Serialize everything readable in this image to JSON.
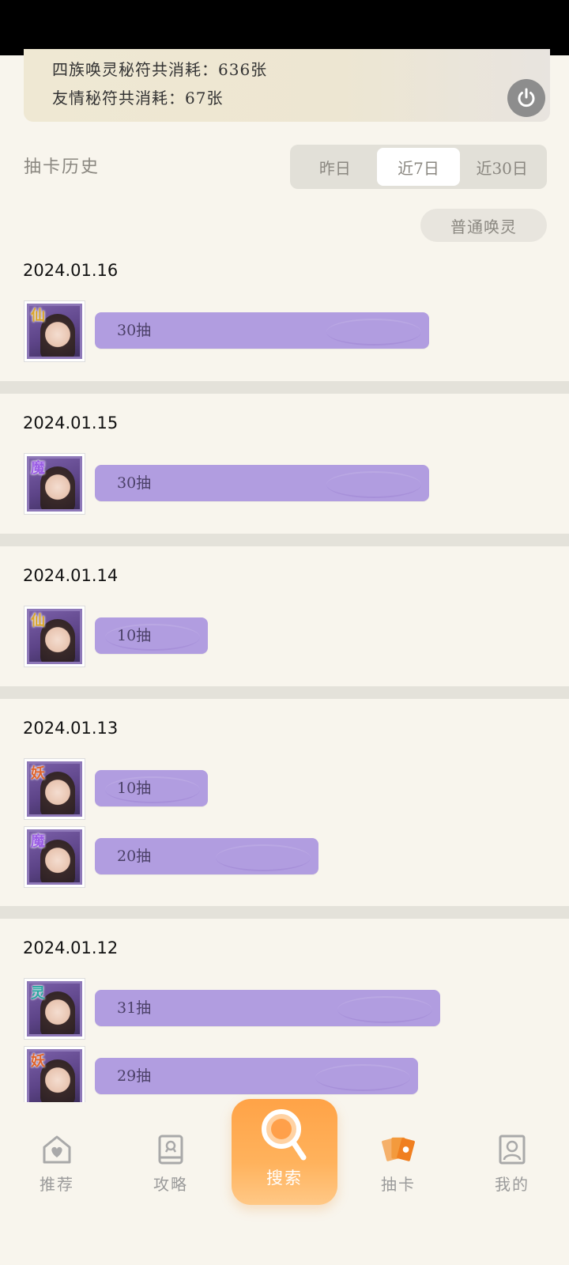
{
  "summary": {
    "line1": "四族唤灵秘符共消耗：636张",
    "line2": "友情秘符共消耗：67张"
  },
  "history": {
    "title": "抽卡历史",
    "tabs": [
      "昨日",
      "近7日",
      "近30日"
    ],
    "active_tab": "近7日",
    "filter": "普通唤灵"
  },
  "groups": [
    {
      "date": "2024.01.16",
      "entries": [
        {
          "badge": "仙",
          "badge_color": "#d9a52a",
          "count": 30,
          "label": "30抽"
        }
      ]
    },
    {
      "date": "2024.01.15",
      "entries": [
        {
          "badge": "魔",
          "badge_color": "#9b5de5",
          "count": 30,
          "label": "30抽"
        }
      ]
    },
    {
      "date": "2024.01.14",
      "entries": [
        {
          "badge": "仙",
          "badge_color": "#d9a52a",
          "count": 10,
          "label": "10抽"
        }
      ]
    },
    {
      "date": "2024.01.13",
      "entries": [
        {
          "badge": "妖",
          "badge_color": "#e0652c",
          "count": 10,
          "label": "10抽"
        },
        {
          "badge": "魔",
          "badge_color": "#9b5de5",
          "count": 20,
          "label": "20抽"
        }
      ]
    },
    {
      "date": "2024.01.12",
      "entries": [
        {
          "badge": "灵",
          "badge_color": "#2aa6a0",
          "count": 31,
          "label": "31抽"
        },
        {
          "badge": "妖",
          "badge_color": "#e0652c",
          "count": 29,
          "label": "29抽"
        }
      ]
    }
  ],
  "nav": {
    "items": [
      {
        "label": "推荐",
        "icon": "heart-home-icon"
      },
      {
        "label": "攻略",
        "icon": "book-icon"
      },
      {
        "label": "搜索",
        "icon": "search-icon"
      },
      {
        "label": "抽卡",
        "icon": "cards-icon"
      },
      {
        "label": "我的",
        "icon": "profile-icon"
      }
    ],
    "active": "抽卡"
  },
  "colors": {
    "bar": "#b19de0",
    "accent": "#f29a3a",
    "background": "#f8f5ed"
  }
}
